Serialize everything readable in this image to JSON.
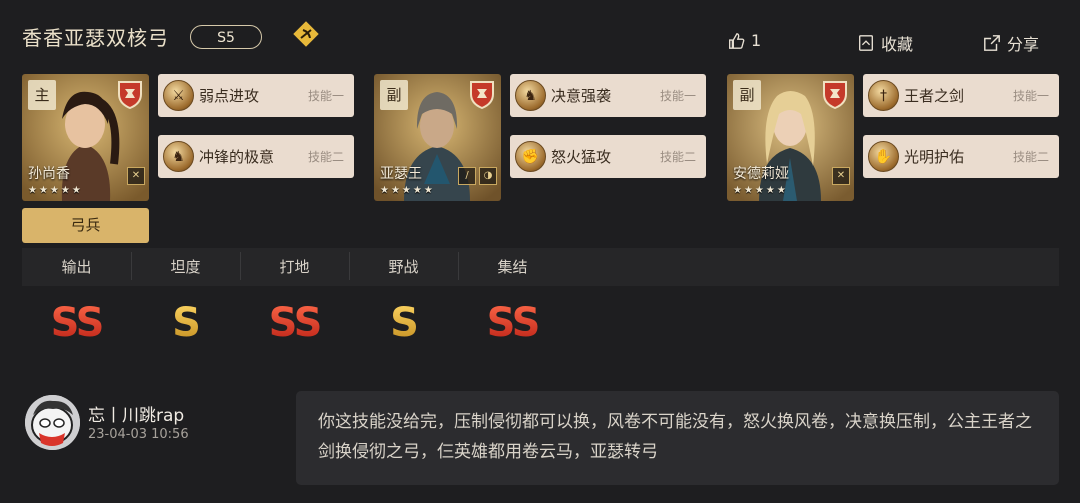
{
  "header": {
    "title": "香香亚瑟双核弓",
    "season": "S5",
    "like_count": "1",
    "favorite_label": "收藏",
    "share_label": "分享"
  },
  "heroes": [
    {
      "role": "主",
      "name": "孙尚香",
      "stars": "★★★★★",
      "skills": [
        {
          "name": "弱点进攻",
          "slot": "技能一"
        },
        {
          "name": "冲锋的极意",
          "slot": "技能二"
        }
      ]
    },
    {
      "role": "副",
      "name": "亚瑟王",
      "stars": "★★★★★",
      "skills": [
        {
          "name": "决意强袭",
          "slot": "技能一"
        },
        {
          "name": "怒火猛攻",
          "slot": "技能二"
        }
      ]
    },
    {
      "role": "副",
      "name": "安德莉娅",
      "stars": "★★★★★",
      "skills": [
        {
          "name": "王者之剑",
          "slot": "技能一"
        },
        {
          "name": "光明护佑",
          "slot": "技能二"
        }
      ]
    }
  ],
  "troop_type": "弓兵",
  "ratings": [
    {
      "label": "输出",
      "grade": "SS"
    },
    {
      "label": "坦度",
      "grade": "S"
    },
    {
      "label": "打地",
      "grade": "SS"
    },
    {
      "label": "野战",
      "grade": "S"
    },
    {
      "label": "集结",
      "grade": "SS"
    }
  ],
  "comment": {
    "user": "忘丨川跳rap",
    "time": "23-04-03 10:56",
    "text": "你这技能没给完，压制侵彻都可以换，风卷不可能没有，怒火换风卷，决意换压制，公主王者之剑换侵彻之弓，仨英雄都用卷云马，亚瑟转弓"
  },
  "colors": {
    "background": "#1e1e20",
    "skill_card": "#eadccf",
    "troop_button": "#d9b46a",
    "grade_ss": "#e0402f",
    "grade_s": "#e2b23c"
  }
}
